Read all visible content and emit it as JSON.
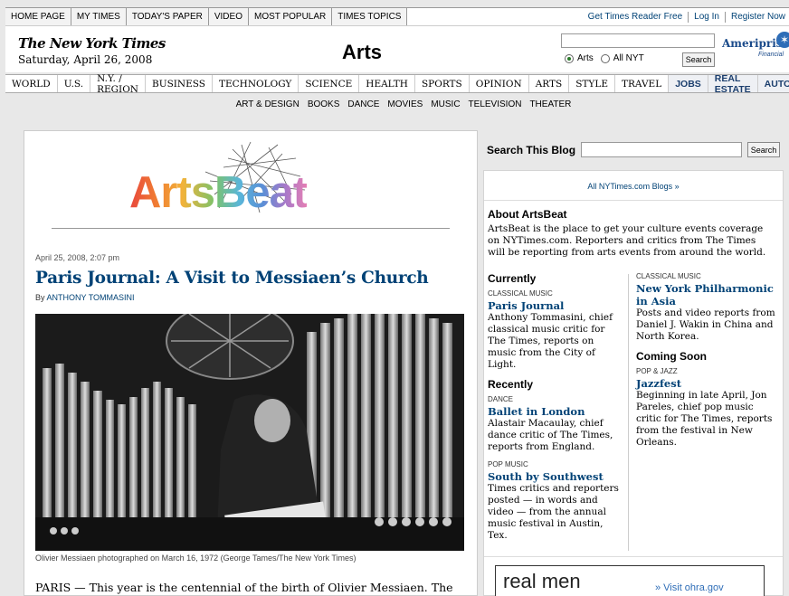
{
  "topbar": {
    "links": [
      "HOME PAGE",
      "MY TIMES",
      "TODAY'S PAPER",
      "VIDEO",
      "MOST POPULAR",
      "TIMES TOPICS"
    ],
    "right_links": [
      "Get Times Reader Free",
      "Log In",
      "Register Now"
    ]
  },
  "masthead": {
    "logo": "The New York Times",
    "date": "Saturday, April 26, 2008",
    "section": "Arts",
    "search_radio_arts": "Arts",
    "search_radio_all": "All NYT",
    "search_button": "Search",
    "sponsor": "Ameriprise",
    "sponsor_sub": "Financial"
  },
  "nav": {
    "items": [
      "WORLD",
      "U.S.",
      "N.Y. / REGION",
      "BUSINESS",
      "TECHNOLOGY",
      "SCIENCE",
      "HEALTH",
      "SPORTS",
      "OPINION",
      "ARTS",
      "STYLE",
      "TRAVEL",
      "JOBS",
      "REAL ESTATE",
      "AUTOS"
    ]
  },
  "subnav": {
    "items": [
      "ART & DESIGN",
      "BOOKS",
      "DANCE",
      "MOVIES",
      "MUSIC",
      "TELEVISION",
      "THEATER"
    ]
  },
  "blog": {
    "title": "ArtsBeat",
    "title_colors": [
      "#e8473d",
      "#f07b32",
      "#f2b33a",
      "#7cc26b",
      "#5ab6d9",
      "#5a8fd6",
      "#a879c9",
      "#e47fb4"
    ]
  },
  "post": {
    "date": "April 25, 2008,  2:07 pm",
    "title": "Paris Journal: A Visit to Messiaen’s Church",
    "by_prefix": "By",
    "author": "ANTHONY TOMMASINI",
    "caption": "Olivier Messiaen photographed on March 16, 1972 (George Tames/The New York Times)",
    "lead": "PARIS — This year is the centennial of the birth of Olivier Messiaen. The"
  },
  "sidebar": {
    "search_label": "Search This Blog",
    "search_button": "Search",
    "all_blogs": "All NYTimes.com Blogs »",
    "about_heading": "About ArtsBeat",
    "about_text": "ArtsBeat is the place to get your culture events coverage on NYTimes.com. Reporters and critics from The Times will be reporting from arts events from around the world.",
    "currently": {
      "heading": "Currently",
      "entries": [
        {
          "kicker": "CLASSICAL MUSIC",
          "title": "Paris Journal",
          "desc": "Anthony Tommasini, chief classical music critic for The Times, reports on music from the City of Light."
        }
      ]
    },
    "recently": {
      "heading": "Recently",
      "entries": [
        {
          "kicker": "DANCE",
          "title": "Ballet in London",
          "desc": "Alastair Macaulay, chief dance critic of The Times, reports from England."
        },
        {
          "kicker": "POP MUSIC",
          "title": "South by Southwest",
          "desc": "Times critics and reporters posted — in words and video — from the annual music festival in Austin, Tex."
        }
      ]
    },
    "col2_first": {
      "kicker": "CLASSICAL MUSIC",
      "title": "New York Philharmonic in Asia",
      "desc": "Posts and video reports from Daniel J. Wakin in China and North Korea."
    },
    "coming_soon": {
      "heading": "Coming Soon",
      "entries": [
        {
          "kicker": "POP & JAZZ",
          "title": "Jazzfest",
          "desc": "Beginning in late April, Jon Pareles, chief pop music critic for The Times, reports from the festival in New Orleans."
        }
      ]
    },
    "ad_text": "real men",
    "ad_link": "» Visit ohra.gov"
  }
}
